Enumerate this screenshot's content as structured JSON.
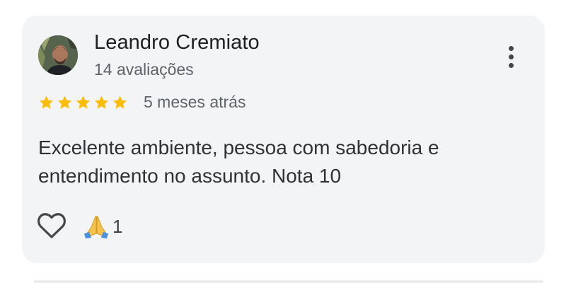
{
  "review": {
    "author_name": "Leandro Cremiato",
    "author_meta": "14 avaliações",
    "rating": 5,
    "rating_max": 5,
    "time_ago": "5 meses atrás",
    "text": "Excelente ambiente, pessoa com sabedoria e entendimento no assunto. Nota 10",
    "reaction_emoji": "🙏",
    "reaction_count": "1"
  },
  "icons": {
    "avatar": "avatar",
    "menu": "more-vert-icon",
    "star": "star-icon",
    "like": "heart-outline-icon",
    "reaction": "praying-hands-icon"
  },
  "colors": {
    "card_bg": "#f3f4f6",
    "star": "#fbbc04",
    "primary_text": "#1f1f1f",
    "secondary_text": "#5f6368"
  }
}
